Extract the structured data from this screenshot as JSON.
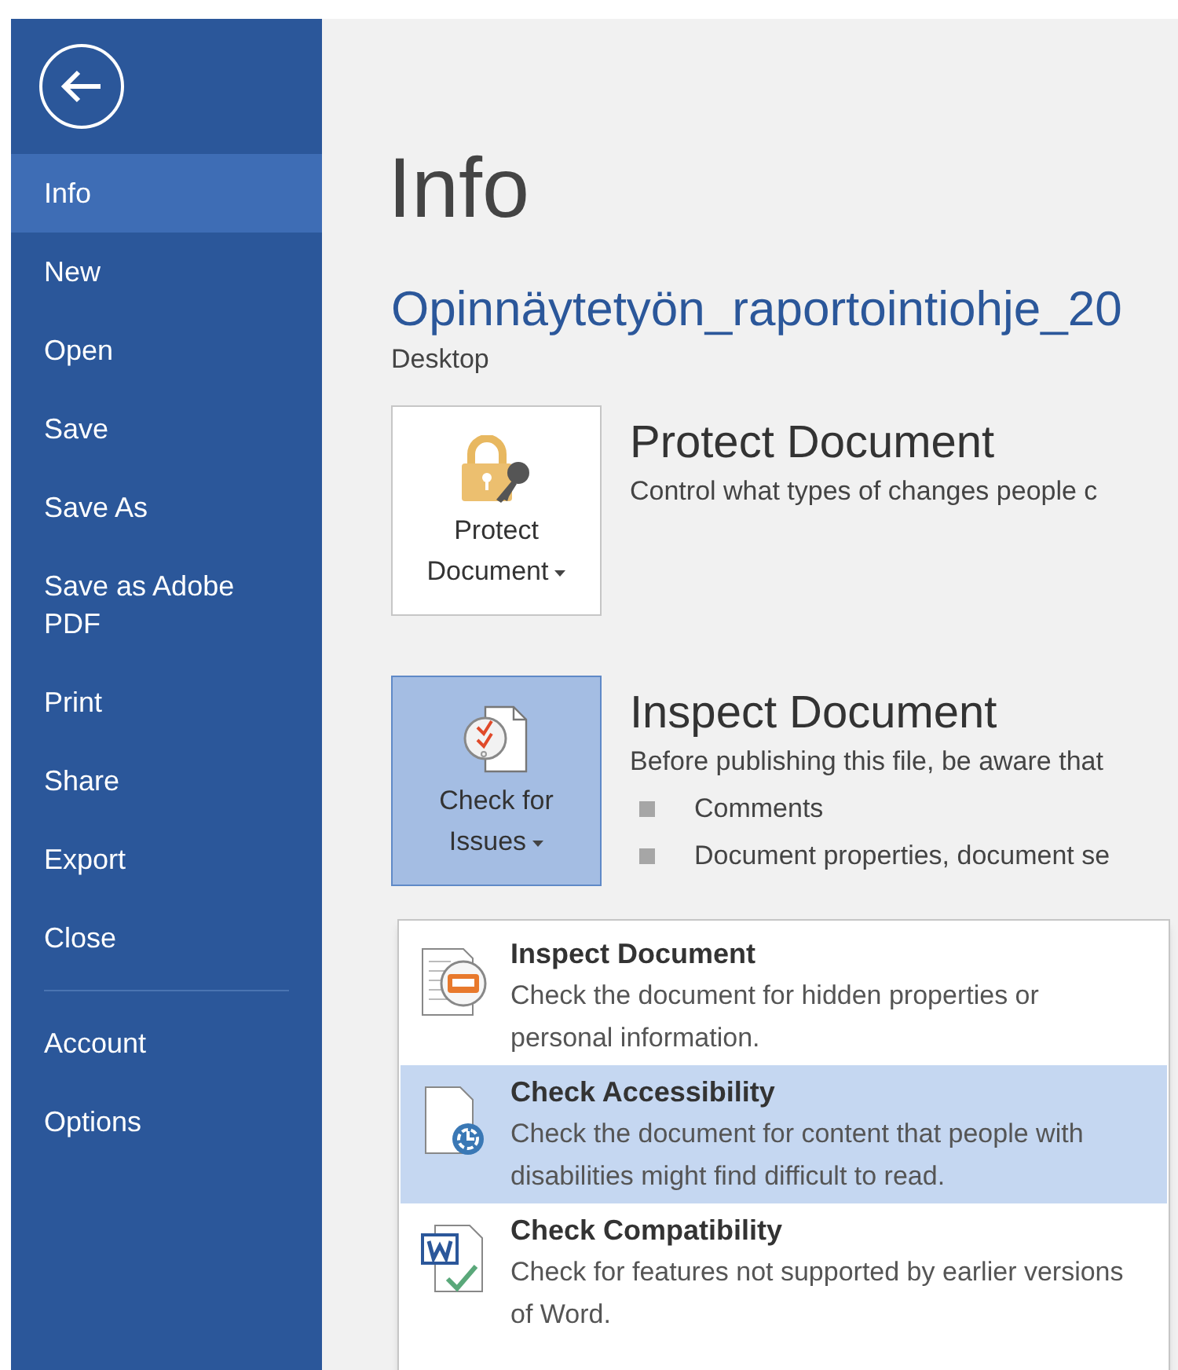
{
  "sidebar": {
    "items": [
      {
        "label": "Info",
        "selected": true
      },
      {
        "label": "New",
        "selected": false
      },
      {
        "label": "Open",
        "selected": false
      },
      {
        "label": "Save",
        "selected": false
      },
      {
        "label": "Save As",
        "selected": false
      },
      {
        "label": "Save as Adobe PDF",
        "selected": false
      },
      {
        "label": "Print",
        "selected": false
      },
      {
        "label": "Share",
        "selected": false
      },
      {
        "label": "Export",
        "selected": false
      },
      {
        "label": "Close",
        "selected": false
      },
      {
        "label": "Account",
        "selected": false,
        "kind": "separated"
      },
      {
        "label": "Options",
        "selected": false
      }
    ]
  },
  "page": {
    "title": "Info",
    "file_name": "Opinnäytetyön_raportointiohje_20",
    "location": "Desktop"
  },
  "sections": [
    {
      "kind": "protect",
      "button": {
        "line1": "Protect",
        "line2": "Document",
        "active": false
      },
      "heading": "Protect Document",
      "description": "Control what types of changes people c"
    },
    {
      "kind": "inspect",
      "button": {
        "line1": "Check for",
        "line2": "Issues",
        "active": true
      },
      "heading": "Inspect Document",
      "description": "Before publishing this file, be aware that",
      "bullets": [
        "Comments",
        "Document properties, document se"
      ]
    }
  ],
  "dropdown": {
    "items": [
      {
        "kind": "inspect",
        "title": "Inspect Document",
        "description": "Check the document for hidden properties or personal information.",
        "selected": false
      },
      {
        "kind": "accessibility",
        "title": "Check Accessibility",
        "description": "Check the document for content that people with disabilities might find difficult to read.",
        "selected": true
      },
      {
        "kind": "compatibility",
        "title": "Check Compatibility",
        "description": "Check for features not supported by earlier versions of Word.",
        "selected": false
      }
    ]
  }
}
